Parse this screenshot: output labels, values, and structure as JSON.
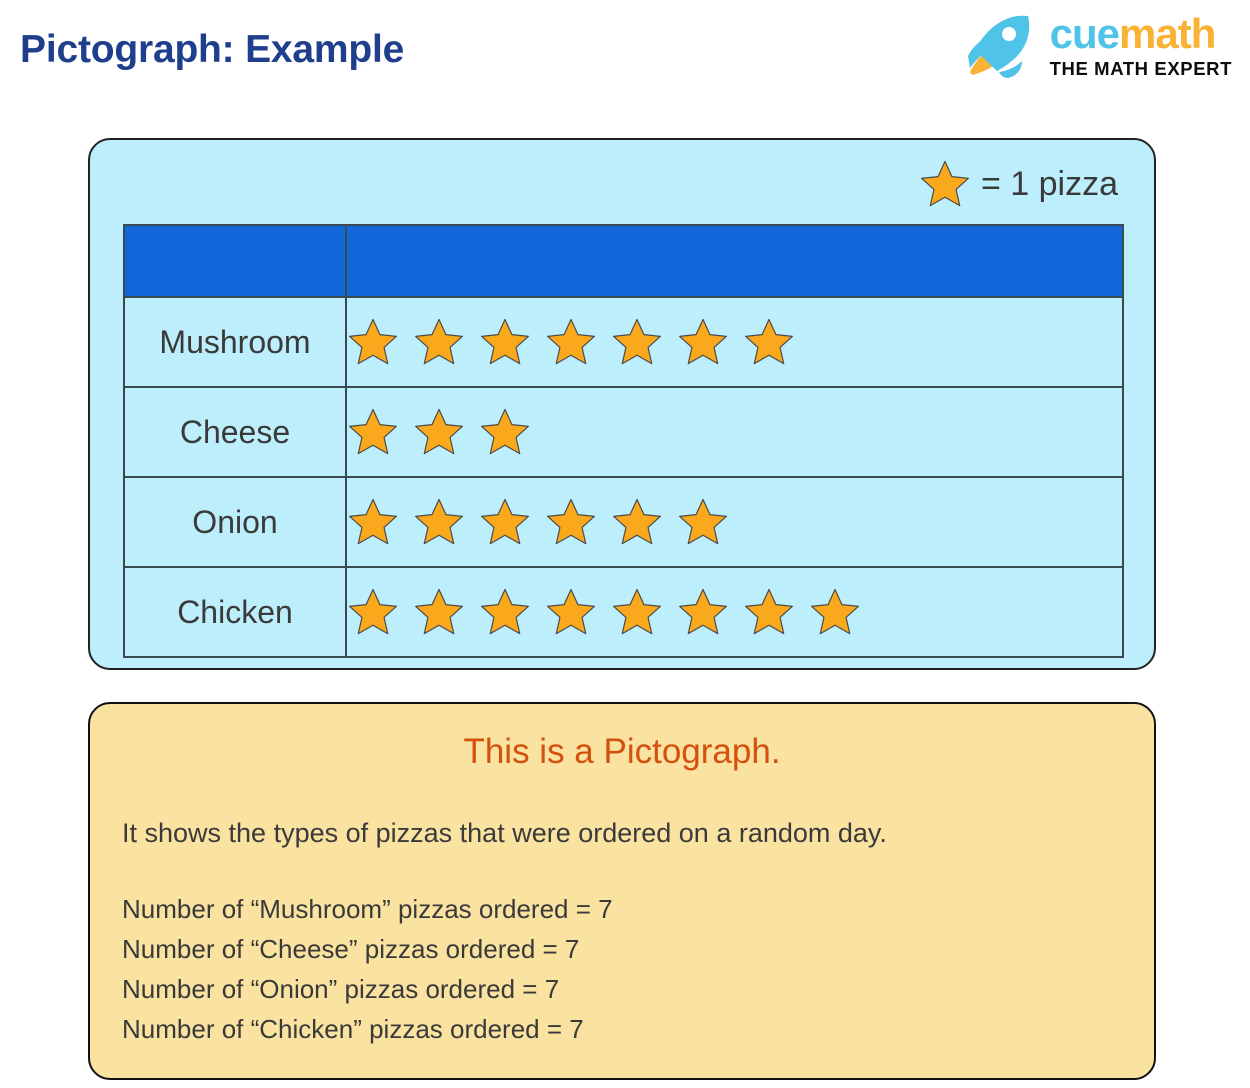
{
  "header": {
    "title": "Pictograph: Example",
    "title_color": "#1f3e8c",
    "brand": {
      "word_part1": "cue",
      "word_part2": "math",
      "tagline": "THE MATH EXPERT",
      "cue_color": "#4fc3e8",
      "math_color": "#f9b233",
      "rocket_body_color": "#4fc3e8",
      "rocket_flame_color": "#f9b233"
    }
  },
  "pictograph": {
    "panel_bg": "#bdeefc",
    "header_row_bg": "#1268da",
    "star_color": "#f9a91b",
    "star_outline": "#4a4a4a",
    "legend": {
      "icon": "star-icon",
      "text": "= 1 pizza"
    },
    "columns": [
      "",
      ""
    ],
    "rows": [
      {
        "label": "Mushroom",
        "stars": 7
      },
      {
        "label": "Cheese",
        "stars": 3
      },
      {
        "label": "Onion",
        "stars": 6
      },
      {
        "label": "Chicken",
        "stars": 8
      }
    ]
  },
  "explanation": {
    "panel_bg": "#fae2a0",
    "heading": "This is a Pictograph.",
    "heading_color": "#d4500f",
    "subtitle": "It shows the types of pizzas that were ordered on a random day.",
    "lines": [
      "Number of “Mushroom” pizzas ordered = 7",
      "Number of “Cheese” pizzas ordered = 7",
      "Number of “Onion” pizzas ordered = 7",
      "Number of “Chicken” pizzas ordered = 7"
    ]
  },
  "chart_data": {
    "type": "table",
    "title": "Pictograph: Example",
    "subtitle": "It shows the types of pizzas that were ordered on a random day.",
    "symbol": "star",
    "symbol_value": 1,
    "symbol_unit": "pizza",
    "legend": "= 1 pizza",
    "categories": [
      "Mushroom",
      "Cheese",
      "Onion",
      "Chicken"
    ],
    "values": [
      7,
      3,
      6,
      8
    ],
    "stated_values": [
      7,
      7,
      7,
      7
    ],
    "xlabel": "",
    "ylabel": "",
    "legend_position": "top-right"
  }
}
